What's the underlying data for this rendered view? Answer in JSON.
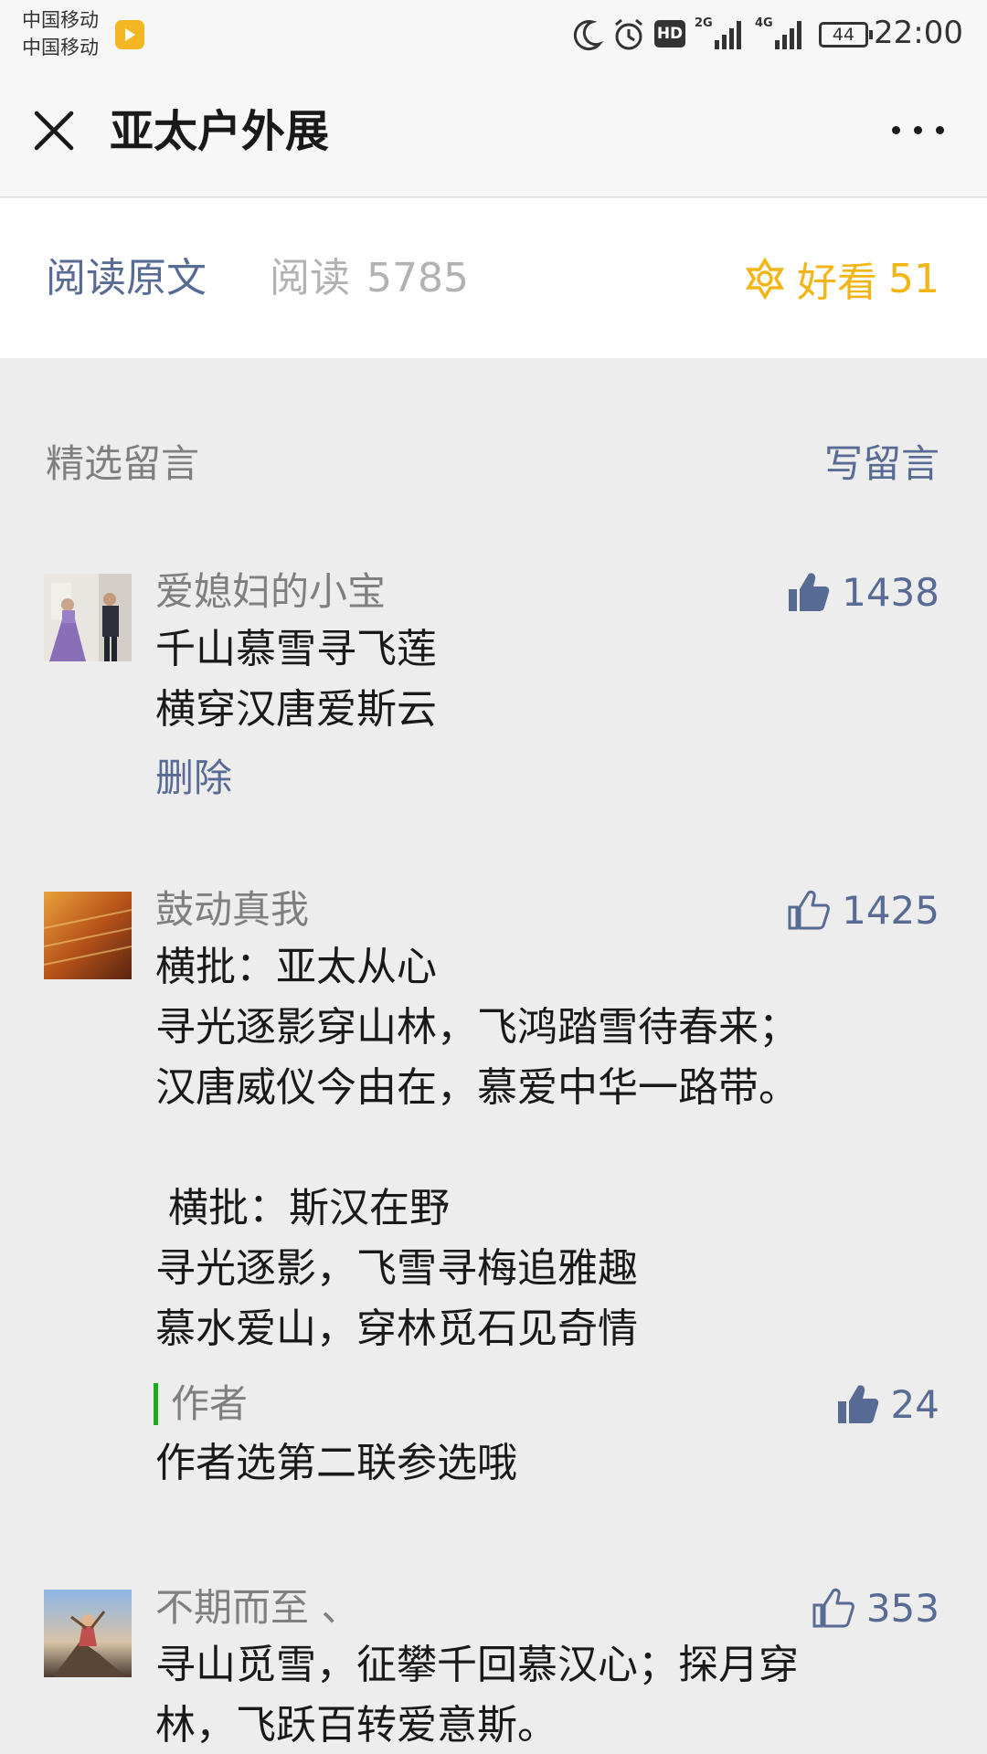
{
  "status_bar": {
    "carrier_1": "中国移动",
    "carrier_2": "中国移动",
    "network_1": "2G",
    "network_2": "4G",
    "hd": "HD",
    "battery": "44",
    "time": "22:00"
  },
  "nav": {
    "title": "亚太户外展"
  },
  "stats": {
    "read_original": "阅读原文",
    "read_label": "阅读",
    "read_count": "5785",
    "wow_label": "好看",
    "wow_count": "51"
  },
  "comments_section": {
    "title": "精选留言",
    "write": "写留言"
  },
  "comments": [
    {
      "nickname": "爱媳妇的小宝",
      "likes": "1438",
      "liked": true,
      "text": "千山慕雪寻飞莲\n横穿汉唐爱斯云",
      "delete_label": "删除"
    },
    {
      "nickname": "鼓动真我",
      "likes": "1425",
      "liked": false,
      "text": "横批：亚太从心\n寻光逐影穿山林，飞鸿踏雪待春来；\n汉唐威仪今由在，慕爱中华一路带。\n\n 横批：斯汉在野\n寻光逐影，飞雪寻梅追雅趣\n慕水爱山，穿林觅石见奇情",
      "reply": {
        "author": "作者",
        "likes": "24",
        "text": "作者选第二联参选哦"
      }
    },
    {
      "nickname": "不期而至 、",
      "likes": "353",
      "liked": false,
      "text": "寻山觅雪，征攀千回慕汉心；探月穿\n林，飞跃百转爱意斯。"
    }
  ],
  "colors": {
    "link": "#576b95",
    "wow": "#f3b515",
    "author_bar": "#1aad19",
    "background": "#ededed"
  }
}
